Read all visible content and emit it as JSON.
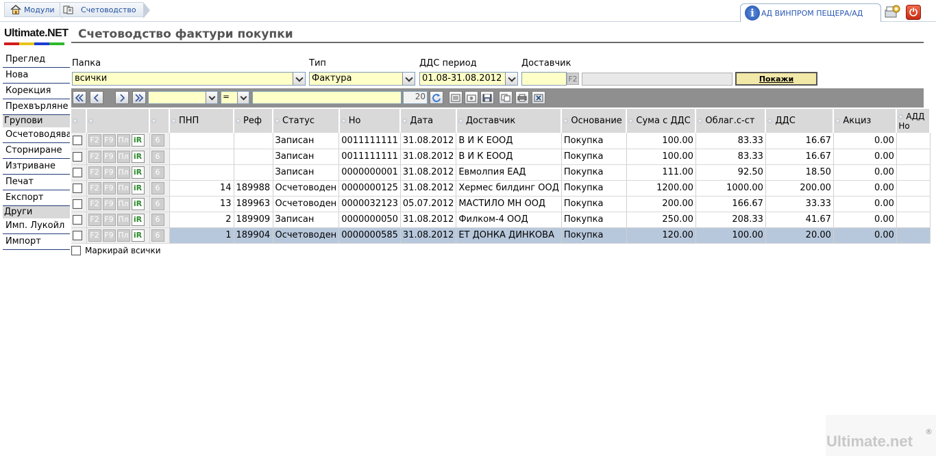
{
  "breadcrumb": [
    {
      "label": "Модули",
      "icon": "home-icon"
    },
    {
      "label": "Счетоводство",
      "icon": "accounting-icon"
    }
  ],
  "company": {
    "name": "АД ВИНПРОМ ПЕЩЕРА/АД"
  },
  "logo": {
    "text": "Ultimate.NET"
  },
  "sidebar": {
    "items_top": [
      "Преглед",
      "Нова",
      "Корекция",
      "Прехвърляне"
    ],
    "group1": "Групови",
    "items_group1": [
      "Осчетоводяване",
      "Сторниране",
      "Изтриване",
      "Печат",
      "Експорт"
    ],
    "group2": "Други",
    "items_group2": [
      "Имп. Лукойл",
      "Импорт"
    ]
  },
  "page": {
    "title": "Счетоводство фактури покупки"
  },
  "filters": {
    "folder_label": "Папка",
    "folder_value": "всички",
    "type_label": "Тип",
    "type_value": "Фактура",
    "vat_period_label": "ДДС период",
    "vat_period_value": "01.08-31.08.2012",
    "supplier_label": "Доставчик",
    "supplier_code": "",
    "supplier_f2": "F2",
    "supplier_name": "",
    "show_button": "Покажи"
  },
  "toolbar": {
    "field_value": "",
    "operator": "=",
    "search_value": "",
    "page_size": "20"
  },
  "table": {
    "columns": [
      "",
      "",
      "",
      "ПНП",
      "Реф",
      "Статус",
      "Но",
      "Дата",
      "Доставчик",
      "Основание",
      "Сума с ДДС",
      "Облаг.с-ст",
      "ДДС",
      "Акциз",
      "АДД Но"
    ],
    "row_buttons": [
      "F2",
      "F9",
      "Пл",
      "iR",
      "6"
    ],
    "rows": [
      {
        "pnp": "",
        "ref": "",
        "status": "Записан",
        "no": "0011111111",
        "date": "31.08.2012",
        "supplier": "В И К ЕООД",
        "basis": "Покупка",
        "total": "100.00",
        "taxable": "83.33",
        "vat": "16.67",
        "excise": "0.00",
        "add_no": ""
      },
      {
        "pnp": "",
        "ref": "",
        "status": "Записан",
        "no": "0011111111",
        "date": "31.08.2012",
        "supplier": "В И К ЕООД",
        "basis": "Покупка",
        "total": "100.00",
        "taxable": "83.33",
        "vat": "16.67",
        "excise": "0.00",
        "add_no": ""
      },
      {
        "pnp": "",
        "ref": "",
        "status": "Записан",
        "no": "0000000001",
        "date": "31.08.2012",
        "supplier": "Евмолпия ЕАД",
        "basis": "Покупка",
        "total": "111.00",
        "taxable": "92.50",
        "vat": "18.50",
        "excise": "0.00",
        "add_no": ""
      },
      {
        "pnp": "14",
        "ref": "189988",
        "status": "Осчетоводен",
        "no": "0000000125",
        "date": "31.08.2012",
        "supplier": "Хермес билдинг ООД",
        "basis": "Покупка",
        "total": "1200.00",
        "taxable": "1000.00",
        "vat": "200.00",
        "excise": "0.00",
        "add_no": ""
      },
      {
        "pnp": "13",
        "ref": "189963",
        "status": "Осчетоводен",
        "no": "0000032123",
        "date": "05.07.2012",
        "supplier": "МАСТИЛО МН ООД",
        "basis": "Покупка",
        "total": "200.00",
        "taxable": "166.67",
        "vat": "33.33",
        "excise": "0.00",
        "add_no": ""
      },
      {
        "pnp": "2",
        "ref": "189909",
        "status": "Записан",
        "no": "0000000050",
        "date": "31.08.2012",
        "supplier": "Филком-4 ООД",
        "basis": "Покупка",
        "total": "250.00",
        "taxable": "208.33",
        "vat": "41.67",
        "excise": "0.00",
        "add_no": ""
      },
      {
        "pnp": "1",
        "ref": "189904",
        "status": "Осчетоводен",
        "no": "0000000585",
        "date": "31.08.2012",
        "supplier": "ЕТ ДОНКА ДИНКОВА",
        "basis": "Покупка",
        "total": "120.00",
        "taxable": "100.00",
        "vat": "20.00",
        "excise": "0.00",
        "add_no": ""
      }
    ],
    "selected_row": 6,
    "mark_all_label": "Маркирай всички"
  },
  "watermark": {
    "text": "Ultimate.net",
    "reg": "®"
  },
  "colors": {
    "input_bg": "#ffffc8",
    "selected_row": "#b8c8dc",
    "toolbar_bg": "#8f8f8f",
    "show_button_bg": "#f2e8a8"
  }
}
